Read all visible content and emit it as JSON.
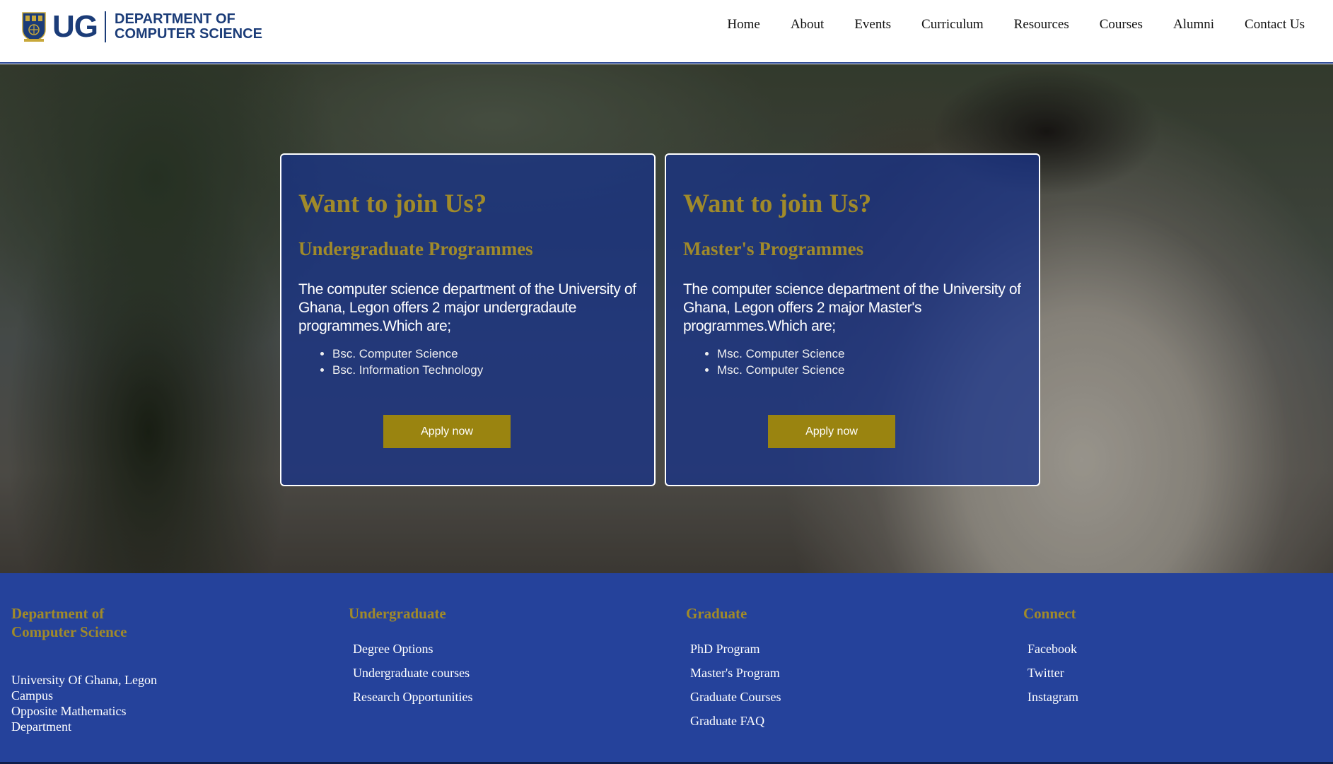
{
  "header": {
    "logo_abbrev": "UG",
    "dept_line1": "DEPARTMENT OF",
    "dept_line2": "COMPUTER SCIENCE",
    "nav": [
      "Home",
      "About",
      "Events",
      "Curriculum",
      "Resources",
      "Courses",
      "Alumni",
      "Contact Us"
    ]
  },
  "cards": [
    {
      "title": "Want to join Us?",
      "subtitle": "Undergraduate Programmes",
      "text": "The computer science department of the University of Ghana, Legon offers 2 major undergradaute programmes.Which are;",
      "items": [
        "Bsc. Computer Science",
        "Bsc. Information Technology"
      ],
      "button": "Apply now"
    },
    {
      "title": "Want to join Us?",
      "subtitle": "Master's Programmes",
      "text": "The computer science department of the University of Ghana, Legon offers 2 major Master's programmes.Which are;",
      "items": [
        "Msc. Computer Science",
        "Msc. Computer Science"
      ],
      "button": "Apply now"
    }
  ],
  "footer": {
    "dept": {
      "heading_line1": "Department of",
      "heading_line2": "Computer Science",
      "address": [
        "University Of Ghana, Legon",
        "Campus",
        "Opposite Mathematics",
        "Department"
      ]
    },
    "undergraduate": {
      "heading": "Undergraduate",
      "links": [
        "Degree Options",
        "Undergraduate courses",
        "Research Opportunities"
      ]
    },
    "graduate": {
      "heading": "Graduate",
      "links": [
        "PhD Program",
        "Master's Program",
        "Graduate Courses",
        "Graduate FAQ"
      ]
    },
    "connect": {
      "heading": "Connect",
      "links": [
        "Facebook",
        "Twitter",
        "Instagram"
      ]
    }
  },
  "colors": {
    "brand_navy": "#1b3c78",
    "gold": "#a08a2a",
    "button_gold": "#9a8410",
    "footer_blue": "#25429b",
    "card_blue": "rgba(22,50,140,0.72)"
  },
  "icons": {
    "logo": "university-crest-icon"
  }
}
